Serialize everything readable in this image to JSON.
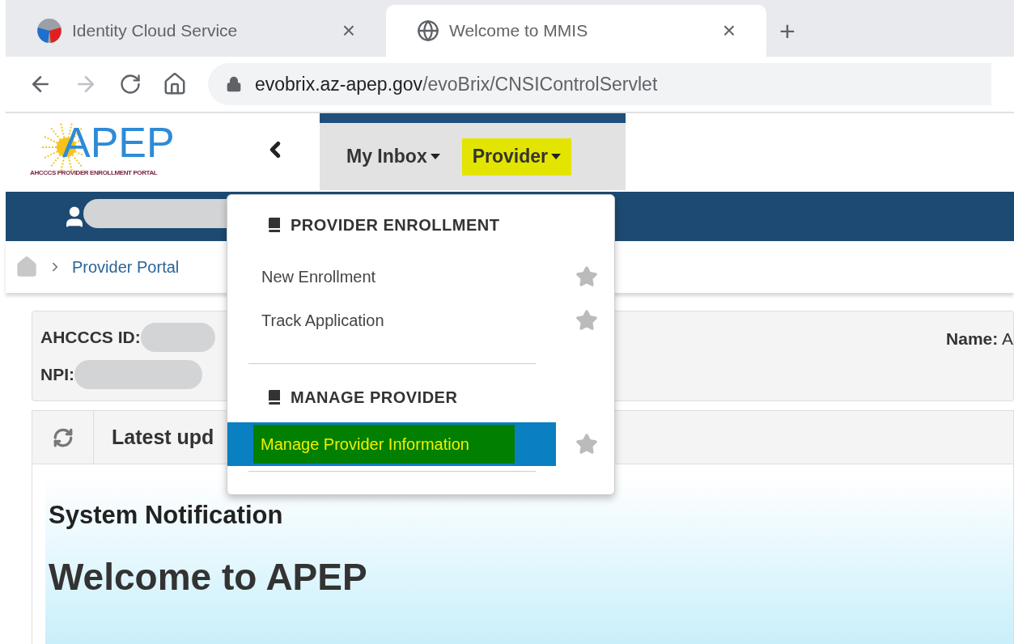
{
  "browser": {
    "tabs": [
      {
        "title": "Identity Cloud Service",
        "selected": false,
        "close": "×"
      },
      {
        "title": "Welcome to MMIS",
        "selected": true,
        "close": "×"
      }
    ],
    "new_tab": "+",
    "url": {
      "host": "evobrix.az-apep.gov",
      "path": "/evoBrix/CNSIControlServlet"
    }
  },
  "header": {
    "logo": {
      "text": "APEP",
      "tagline": "AHCCCS PROVIDER ENROLLMENT PORTAL"
    },
    "nav": [
      {
        "label": "My Inbox",
        "selected": false
      },
      {
        "label": "Provider",
        "selected": true
      }
    ]
  },
  "breadcrumb": [
    "Provider Portal"
  ],
  "provider_info": {
    "fields": [
      {
        "label": "AHCCCS ID:"
      },
      {
        "label": "NPI:"
      }
    ],
    "name": {
      "label": "Name:",
      "value": "A"
    }
  },
  "updates": {
    "title": "Latest upd"
  },
  "notification": {
    "title": "System Notification",
    "heading": "Welcome to APEP"
  },
  "menu": {
    "sections": [
      {
        "title": "PROVIDER ENROLLMENT",
        "items": [
          {
            "label": "New Enrollment",
            "selected": false
          },
          {
            "label": "Track Application",
            "selected": false
          }
        ]
      },
      {
        "title": "MANAGE PROVIDER",
        "items": [
          {
            "label": "Manage Provider Information",
            "selected": true
          }
        ]
      }
    ]
  }
}
